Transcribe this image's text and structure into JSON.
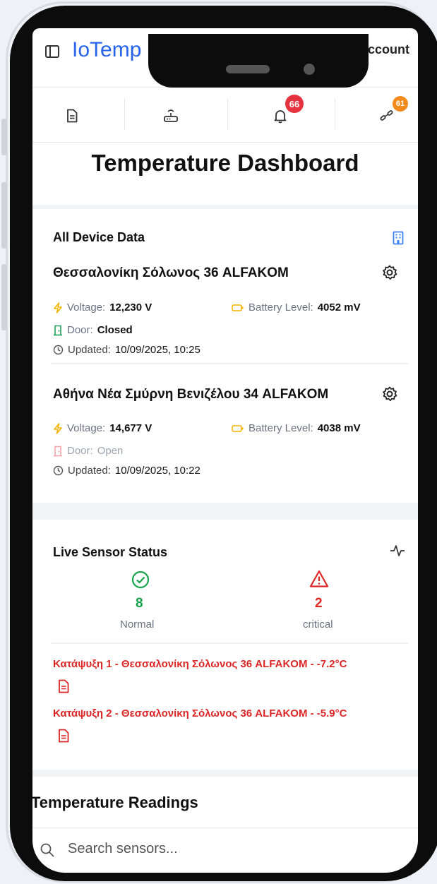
{
  "header": {
    "brand": "IoTemp",
    "account_label": "Account"
  },
  "iconbar": {
    "items": [
      {
        "icon": "document-icon"
      },
      {
        "icon": "router-icon"
      },
      {
        "icon": "bell-icon",
        "badge": "66",
        "badge_color": "#e5323e"
      },
      {
        "icon": "link-icon",
        "badge": "61",
        "badge_color": "#f28a1c"
      }
    ]
  },
  "page": {
    "title": "Temperature Dashboard"
  },
  "devices": {
    "title": "All Device Data",
    "items": [
      {
        "name": "Θεσσαλονίκη Σόλωνος 36 ALFAKOM",
        "voltage_label": "Voltage:",
        "voltage": "12,230 V",
        "battery_label": "Battery Level:",
        "battery": "4052 mV",
        "door_label": "Door:",
        "door": "Closed",
        "updated_label": "Updated:",
        "updated": "10/09/2025, 10:25"
      },
      {
        "name": "Αθήνα Νέα Σμύρνη Βενιζέλου 34 ALFAKOM",
        "voltage_label": "Voltage:",
        "voltage": "14,677 V",
        "battery_label": "Battery Level:",
        "battery": "4038 mV",
        "door_label": "Door:",
        "door": "Open",
        "updated_label": "Updated:",
        "updated": "10/09/2025, 10:22"
      }
    ]
  },
  "live_status": {
    "title": "Live Sensor Status",
    "normal_count": "8",
    "normal_label": "Normal",
    "critical_count": "2",
    "critical_label": "critical",
    "alerts": [
      "Κατάψυξη 1 - Θεσσαλονίκη Σόλωνος 36 ALFAKOM - -7.2°C",
      "Κατάψυξη 2 - Θεσσαλονίκη Σόλωνος 36 ALFAKOM - -5.9°C"
    ]
  },
  "readings": {
    "title": "Temperature Readings",
    "search_placeholder": "Search sensors..."
  },
  "colors": {
    "brand": "#2563eb",
    "normal": "#16a34a",
    "critical": "#dc2626",
    "voltage_icon": "#f5b301",
    "door_closed": "#22a05a",
    "door_open": "#f3a7a7"
  }
}
